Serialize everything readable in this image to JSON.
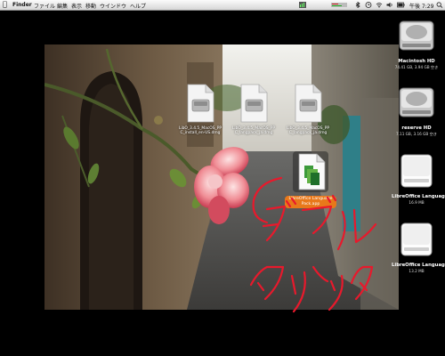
{
  "menubar": {
    "apple": "",
    "items": [
      "Finder",
      "ファイル",
      "編集",
      "表示",
      "移動",
      "ウインドウ",
      "ヘルプ"
    ],
    "clock": "午後 7:29"
  },
  "window_files": [
    {
      "label_line1": "LibO_3.4.5_MacOS_PP",
      "label_line2": "C_install_en-US.dmg"
    },
    {
      "label_line1": "LibO_3.4.5_MacOS_PP",
      "label_line2": "C_langpack_ja.dmg"
    },
    {
      "label_line1": "LibO_3.4.5_MacOS_PP",
      "label_line2": "C_langpack_ja.dmg"
    }
  ],
  "selected_item": {
    "label_line1": "LibreOffice Language",
    "label_line2": "Pack.app"
  },
  "drives": [
    {
      "name": "Macintosh HD",
      "info": "74.41 GB, 3.94 GB 空き"
    },
    {
      "name": "reserve HD",
      "info": "7.11 GB, 3.16 GB 空き"
    },
    {
      "name": "LibreOffice Language Pack",
      "info": "16.9 MB"
    },
    {
      "name": "LibreOffice Language Pack",
      "info": "13.2 MB"
    }
  ],
  "annotation_text": "ダブルクリック",
  "colors": {
    "annotation": "#e8192c",
    "selection": "#e8781a"
  }
}
